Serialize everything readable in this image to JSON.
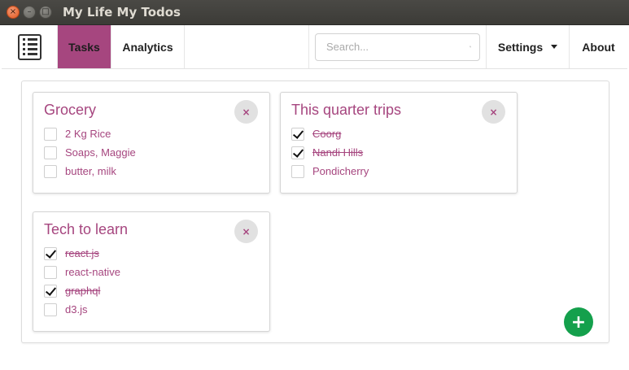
{
  "window": {
    "title": "My Life My Todos",
    "close_glyph": "×",
    "min_glyph": "–",
    "max_glyph": "□"
  },
  "nav": {
    "tabs": [
      {
        "label": "Tasks",
        "active": true
      },
      {
        "label": "Analytics",
        "active": false
      }
    ],
    "search": {
      "placeholder": "Search...",
      "value": ""
    },
    "settings_label": "Settings",
    "about_label": "About"
  },
  "lists": [
    {
      "title": "Grocery",
      "items": [
        {
          "label": "2 Kg Rice",
          "done": false
        },
        {
          "label": "Soaps, Maggie",
          "done": false
        },
        {
          "label": "butter, milk",
          "done": false
        }
      ]
    },
    {
      "title": "This quarter trips",
      "items": [
        {
          "label": "Coorg",
          "done": true
        },
        {
          "label": "Nandi Hills",
          "done": true
        },
        {
          "label": "Pondicherry",
          "done": false
        }
      ]
    },
    {
      "title": "Tech to learn",
      "items": [
        {
          "label": "react.js",
          "done": true
        },
        {
          "label": "react-native",
          "done": false
        },
        {
          "label": "graphql",
          "done": true
        },
        {
          "label": "d3.js",
          "done": false
        }
      ]
    }
  ],
  "close_glyph": "×",
  "add_glyph": "+",
  "colors": {
    "accent": "#a6467f",
    "fab": "#14a04c"
  },
  "icons": {
    "brand": "list-icon",
    "search": "search-icon",
    "add": "plus-icon",
    "remove": "close-icon"
  }
}
